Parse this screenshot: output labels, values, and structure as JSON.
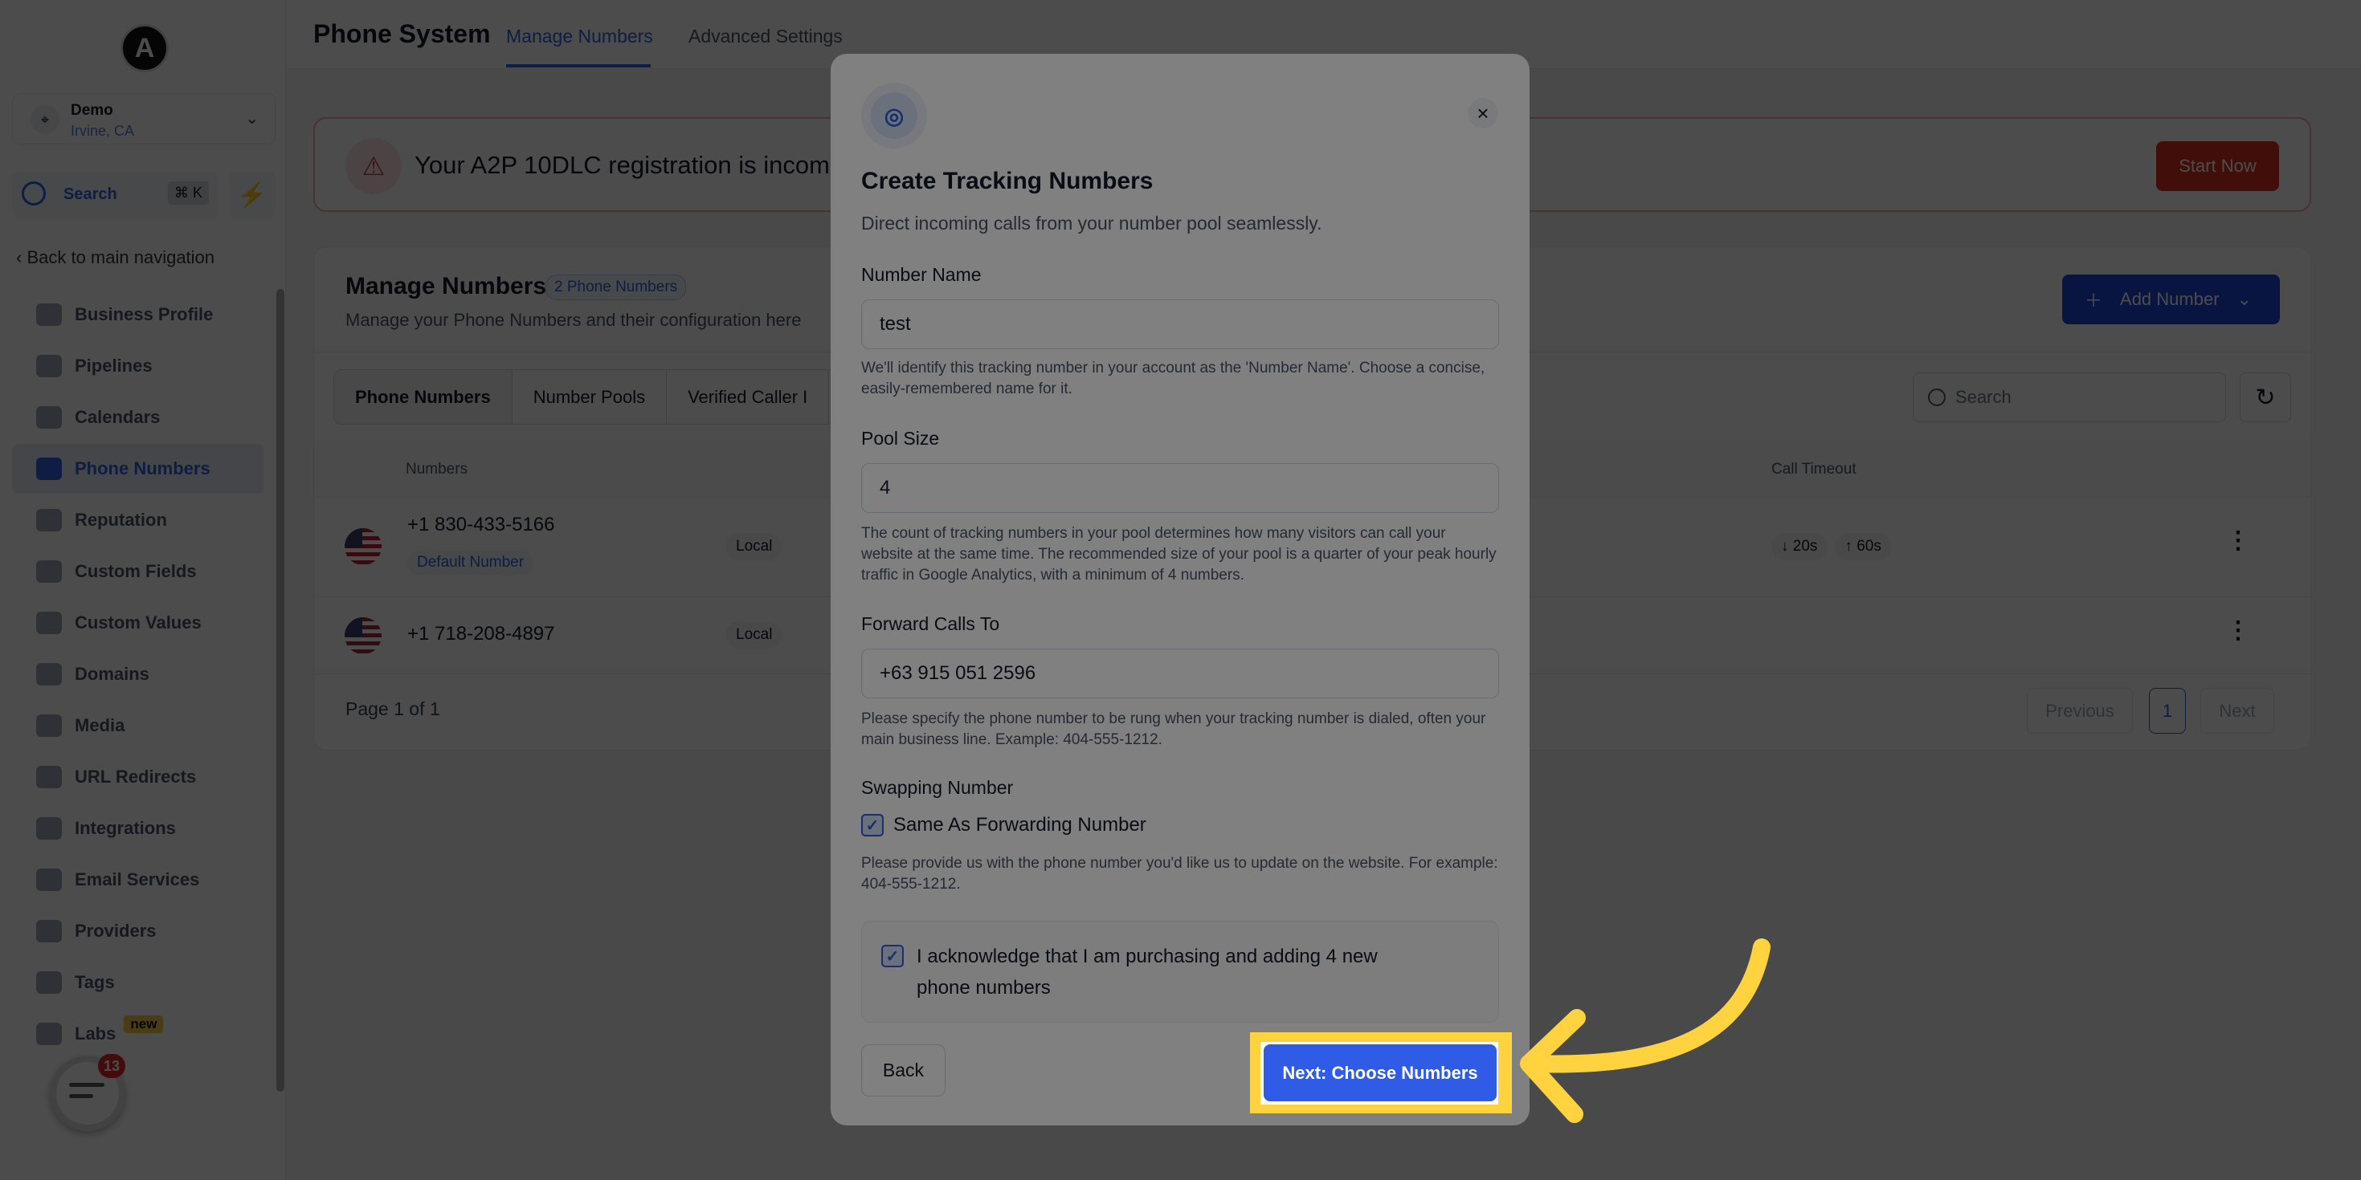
{
  "sidebar": {
    "logo": "A",
    "account_name": "Demo",
    "account_location": "Irvine, CA",
    "search_label": "Search",
    "search_shortcut": "⌘ K",
    "back_label": "Back to main navigation",
    "items": [
      {
        "label": "Business Profile"
      },
      {
        "label": "Pipelines"
      },
      {
        "label": "Calendars"
      },
      {
        "label": "Phone Numbers",
        "active": true
      },
      {
        "label": "Reputation"
      },
      {
        "label": "Custom Fields"
      },
      {
        "label": "Custom Values"
      },
      {
        "label": "Domains"
      },
      {
        "label": "Media"
      },
      {
        "label": "URL Redirects"
      },
      {
        "label": "Integrations"
      },
      {
        "label": "Email Services"
      },
      {
        "label": "Providers"
      },
      {
        "label": "Tags"
      },
      {
        "label": "Labs",
        "badge": "new"
      }
    ],
    "chat_badge": "13"
  },
  "header": {
    "title": "Phone System",
    "tabs": [
      {
        "label": "Manage Numbers",
        "active": true
      },
      {
        "label": "Advanced Settings"
      }
    ]
  },
  "alert": {
    "text": "Your A2P 10DLC registration is incomp",
    "button": "Start Now"
  },
  "manage": {
    "title": "Manage Numbers",
    "count_badge": "2 Phone Numbers",
    "subtitle": "Manage your Phone Numbers and their configuration here",
    "add_button": "Add Number",
    "tabs": [
      "Phone Numbers",
      "Number Pools",
      "Verified Caller I"
    ],
    "search_placeholder": "Search",
    "columns": {
      "numbers": "Numbers",
      "call_timeout": "Call Timeout"
    },
    "rows": [
      {
        "number": "+1 830-433-5166",
        "default_badge": "Default Number",
        "type": "Local",
        "timeout_in": "20s",
        "timeout_out": "60s"
      },
      {
        "number": "+1 718-208-4897",
        "type": "Local"
      }
    ],
    "pagination": {
      "label": "Page 1 of 1",
      "previous": "Previous",
      "current": "1",
      "next": "Next"
    }
  },
  "modal": {
    "title": "Create Tracking Numbers",
    "subtitle": "Direct incoming calls from your number pool seamlessly.",
    "number_name": {
      "label": "Number Name",
      "value": "test",
      "help": "We'll identify this tracking number in your account as the 'Number Name'. Choose a concise, easily-remembered name for it."
    },
    "pool_size": {
      "label": "Pool Size",
      "value": "4",
      "help": "The count of tracking numbers in your pool determines how many visitors can call your website at the same time. The recommended size of your pool is a quarter of your peak hourly traffic in Google Analytics, with a minimum of 4 numbers."
    },
    "forward": {
      "label": "Forward Calls To",
      "value": "+63 915 051 2596",
      "help": "Please specify the phone number to be rung when your tracking number is dialed, often your main business line. Example: 404-555-1212."
    },
    "swapping": {
      "label": "Swapping Number",
      "checkbox": "Same As Forwarding Number",
      "checked": true,
      "help": "Please provide us with the phone number you'd like us to update on the website. For example: 404-555-1212."
    },
    "acknowledge": {
      "text": "I acknowledge that I am purchasing and adding 4 new phone numbers",
      "checked": true
    },
    "back_button": "Back",
    "next_button": "Next: Choose Numbers"
  },
  "colors": {
    "accent": "#2f5be7",
    "highlight": "#ffd23f",
    "danger": "#d92d20"
  }
}
